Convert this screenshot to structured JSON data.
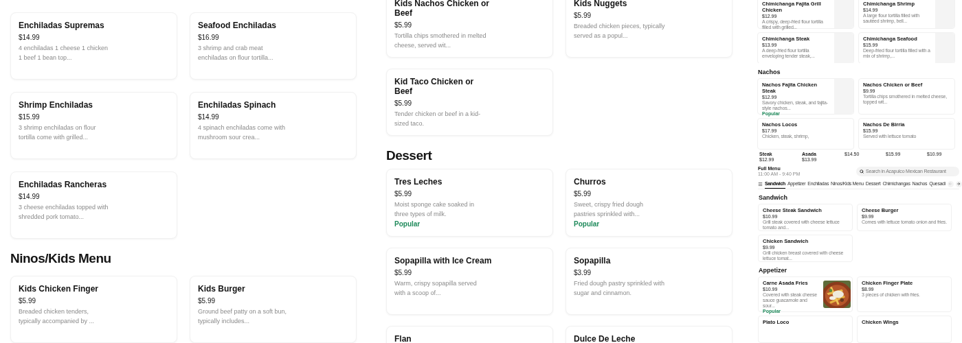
{
  "panels": [
    {
      "blocks": [
        {
          "kind": "cards",
          "items": [
            {
              "title": "Enchiladas Supremas",
              "price": "$14.99",
              "description": "4 enchiladas 1 cheese 1 chicken 1 beef 1 bean top..."
            },
            {
              "title": "Seafood Enchiladas",
              "price": "$16.99",
              "description": "3 shrimp and crab meat enchiladas on flour tortilla..."
            },
            {
              "title": "Shrimp Enchiladas",
              "price": "$15.99",
              "description": "3 shrimp enchiladas on flour tortilla come with grilled..."
            },
            {
              "title": "Enchiladas Spinach",
              "price": "$14.99",
              "description": "4 spinach enchiladas come with mushroom sour crea..."
            },
            {
              "title": "Enchiladas Rancheras",
              "price": "$14.99",
              "description": "3 cheese enchiladas topped with shredded pork tomato..."
            }
          ]
        },
        {
          "kind": "heading",
          "text": "Ninos/Kids Menu"
        },
        {
          "kind": "cards",
          "items": [
            {
              "title": "Kids Chicken Finger",
              "price": "$5.99",
              "description": "Breaded chicken tenders, typically accompanied by ..."
            },
            {
              "title": "Kids Burger",
              "price": "$5.99",
              "description": "Ground beef patty on a soft bun, typically includes..."
            }
          ]
        }
      ]
    },
    {
      "blocks": [
        {
          "kind": "cards",
          "items": [
            {
              "title": "Kids Nachos Chicken or Beef",
              "price": "$5.99",
              "description": "Tortilla chips smothered in melted cheese, served wit..."
            },
            {
              "title": "Kids Nuggets",
              "price": "$5.99",
              "description": "Breaded chicken pieces, typically served as a popul..."
            },
            {
              "title": "Kid Taco Chicken or Beef",
              "price": "$5.99",
              "description": "Tender chicken or beef in a kid-sized taco."
            }
          ]
        },
        {
          "kind": "heading",
          "text": "Dessert"
        },
        {
          "kind": "cards",
          "items": [
            {
              "title": "Tres Leches",
              "price": "$5.99",
              "description": "Moist sponge cake soaked in three types of milk.",
              "badge": "Popular"
            },
            {
              "title": "Churros",
              "price": "$5.99",
              "description": "Sweet, crispy fried dough pastries sprinkled with...",
              "badge": "Popular"
            },
            {
              "title": "Sopapilla with Ice Cream",
              "price": "$5.99",
              "description": "Warm, crispy sopapilla served with a scoop of..."
            },
            {
              "title": "Sopapilla",
              "price": "$3.99",
              "description": "Fried dough pastry sprinkled with sugar and cinnamon."
            },
            {
              "title": "Flan"
            },
            {
              "title": "Dulce De Leche"
            }
          ]
        }
      ]
    }
  ],
  "preview": {
    "blocks": [
      {
        "kind": "cards",
        "items": [
          {
            "title": "Chimichanga Fajita Grill Chicken",
            "price": "$12.99",
            "description": "A crispy, deep-fried flour tortilla filled with grilled...",
            "image_slot": true
          },
          {
            "title": "Chimichanga Shrimp",
            "price": "$14.99",
            "description": "A large flour tortilla filled with sautéed shrimp, bell...",
            "image_slot": true
          },
          {
            "title": "Chimichanga Steak",
            "price": "$13.99",
            "description": "A deep-fried flour tortilla enveloping tender steak,...",
            "image_slot": true
          },
          {
            "title": "Chimichanga Seafood",
            "price": "$15.99",
            "description": "Deep-fried flour tortilla filled with a mix of shrimp,...",
            "image_slot": true
          }
        ]
      },
      {
        "kind": "heading",
        "text": "Nachos"
      },
      {
        "kind": "cards",
        "items": [
          {
            "title": "Nachos Fajita Chicken Steak",
            "price": "$12.99",
            "description": "Savory chicken, steak, and fajita-style nachos...",
            "badge": "Popular",
            "image_slot": true
          },
          {
            "title": "Nachos Chicken or Beef",
            "price": "$9.99",
            "description": "Tortilla chips smothered in melted cheese, topped wit..."
          },
          {
            "title": "Nachos Locos",
            "price": "$17.99",
            "description": "Chicken, steak, shrimp,"
          },
          {
            "title": "Nachos De Birria",
            "price": "$15.99",
            "description": "Served with lettuce tomato"
          }
        ]
      },
      {
        "kind": "strip",
        "cells": [
          {
            "name": "Steak",
            "price": "$12.99"
          },
          {
            "name": "Asada",
            "price": "$13.99"
          },
          {
            "price": "$14.50"
          },
          {
            "price": "$15.99"
          },
          {
            "price": "$10.99"
          }
        ]
      },
      {
        "kind": "menubar",
        "title": "Full Menu",
        "hours": "11:00 AM - 9:40 PM",
        "search_placeholder": "Search in Acapulco Mexican Restaurant",
        "tabs": [
          {
            "label": "Sandwich",
            "selected": true
          },
          {
            "label": "Appetizer",
            "selected": false
          },
          {
            "label": "Enchiladas",
            "selected": false
          },
          {
            "label": "Ninos/Kids Menu",
            "selected": false
          },
          {
            "label": "Dessert",
            "selected": false
          },
          {
            "label": "Chimichangas",
            "selected": false
          },
          {
            "label": "Nachos",
            "selected": false
          },
          {
            "label": "Quesadi",
            "selected": false
          }
        ]
      },
      {
        "kind": "heading",
        "text": "Sandwich"
      },
      {
        "kind": "cards",
        "items": [
          {
            "title": "Cheese Steak Sandwich",
            "price": "$10.99",
            "description": "Grill steak covered with cheese lettuce tomato and..."
          },
          {
            "title": "Cheese Burger",
            "price": "$9.99",
            "description": "Comes with lettuce tomato onion and fries."
          },
          {
            "title": "Chicken Sandwich",
            "price": "$9.99",
            "description": "Grill chicken breast covered with cheese lettuce tomat..."
          }
        ]
      },
      {
        "kind": "heading",
        "text": "Appetizer"
      },
      {
        "kind": "cards",
        "items": [
          {
            "title": "Carne Asada Fries",
            "price": "$10.99",
            "description": "Covered with steak cheese sauce guacamole and sour...",
            "badge": "Popular",
            "kind": "picture"
          },
          {
            "title": "Chicken Finger Plate",
            "price": "$8.99",
            "description": "3 pieces of chicken with fries."
          },
          {
            "title": "Plato Loco"
          },
          {
            "title": "Chicken Wings"
          }
        ]
      }
    ]
  }
}
